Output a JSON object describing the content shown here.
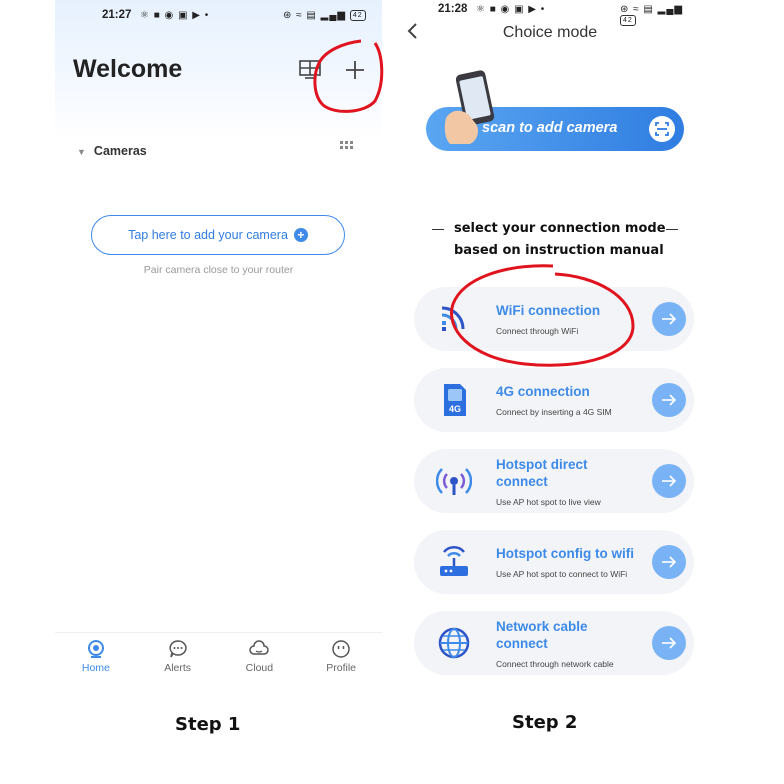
{
  "screen1": {
    "status_time": "21:27",
    "status_battery": "42",
    "header_title": "Welcome",
    "section_label": "Cameras",
    "add_camera_button": "Tap here to add your camera",
    "hint": "Pair camera close to your router",
    "tabs": [
      {
        "label": "Home",
        "icon": "home-icon"
      },
      {
        "label": "Alerts",
        "icon": "chat-bubble-icon"
      },
      {
        "label": "Cloud",
        "icon": "cloud-icon"
      },
      {
        "label": "Profile",
        "icon": "smiley-icon"
      }
    ],
    "step_label": "Step 1"
  },
  "screen2": {
    "status_time": "21:28",
    "status_battery": "42",
    "title": "Choice mode",
    "scan_banner": "scan to add camera",
    "instruction_line1": "select your connection mode",
    "instruction_line2": "based on instruction manual",
    "modes": [
      {
        "name": "WiFi connection",
        "desc": "Connect through WiFi",
        "icon": "wifi-signal-icon"
      },
      {
        "name": "4G connection",
        "desc": "Connect by inserting a 4G SIM",
        "icon": "sim-card-icon"
      },
      {
        "name_line1": "Hotspot direct",
        "name_line2": "connect",
        "desc": "Use AP hot spot to live view",
        "icon": "hotspot-icon"
      },
      {
        "name": "Hotspot config to wifi",
        "desc": "Use AP hot spot to connect to WiFi",
        "icon": "router-icon"
      },
      {
        "name_line1": "Network cable",
        "name_line2": "connect",
        "desc": "Connect through network cable",
        "icon": "network-globe-icon"
      }
    ],
    "step_label": "Step 2"
  },
  "colors": {
    "accent": "#3d8ae8",
    "annotation": "#e0141e",
    "card_bg": "#f3f4f7",
    "arrow_bg": "#79b3f5"
  }
}
